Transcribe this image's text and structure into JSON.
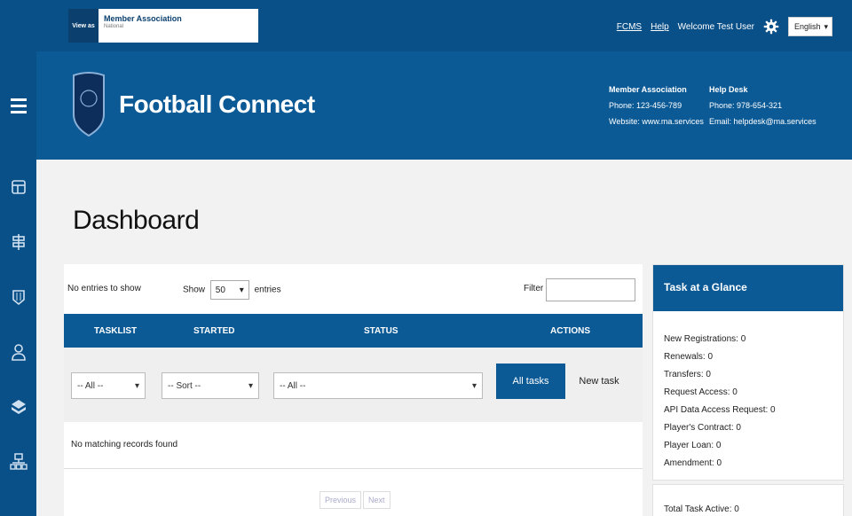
{
  "topbar": {
    "view_as": "View as",
    "member_association": "Member Association",
    "member_association_sub": "National",
    "links": {
      "fcms": "FCMS",
      "help": "Help"
    },
    "welcome": "Welcome Test User",
    "language": "English"
  },
  "brand": {
    "name": "Football Connect",
    "contact_member": {
      "heading": "Member Association",
      "phone": "Phone: 123-456-789",
      "website": "Website: www.ma.services"
    },
    "contact_help": {
      "heading": "Help Desk",
      "phone": "Phone: 978-654-321",
      "email": "Email: helpdesk@ma.services"
    }
  },
  "page": {
    "title": "Dashboard"
  },
  "table": {
    "entries_info": "No entries to show",
    "show_label": "Show",
    "show_value": "50",
    "entries_label": "entries",
    "filter_label": "Filter",
    "columns": [
      "TASKLIST",
      "STARTED",
      "STATUS",
      "ACTIONS"
    ],
    "filters": {
      "tasklist": "-- All --",
      "started": "-- Sort --",
      "status": "-- All --"
    },
    "btn_all_tasks": "All tasks",
    "btn_new_task": "New task",
    "empty_message": "No matching records found",
    "pager": {
      "prev": "Previous",
      "next": "Next"
    }
  },
  "glance": {
    "title": "Task at a Glance",
    "items": [
      "New Registrations: 0",
      "Renewals: 0",
      "Transfers: 0",
      "Request Access: 0",
      "API Data Access Request: 0",
      "Player's Contract: 0",
      "Player Loan: 0",
      "Amendment: 0"
    ],
    "total": "Total Task Active: 0"
  },
  "colors": {
    "primary": "#0b5a96",
    "topbar": "#0a5088",
    "background": "#f2f2f2"
  },
  "icons": [
    "menu-icon",
    "dashboard-icon",
    "signpost-icon",
    "kit-icon",
    "person-icon",
    "cube-icon",
    "org-chart-icon",
    "gear-icon",
    "shield-logo-icon"
  ]
}
